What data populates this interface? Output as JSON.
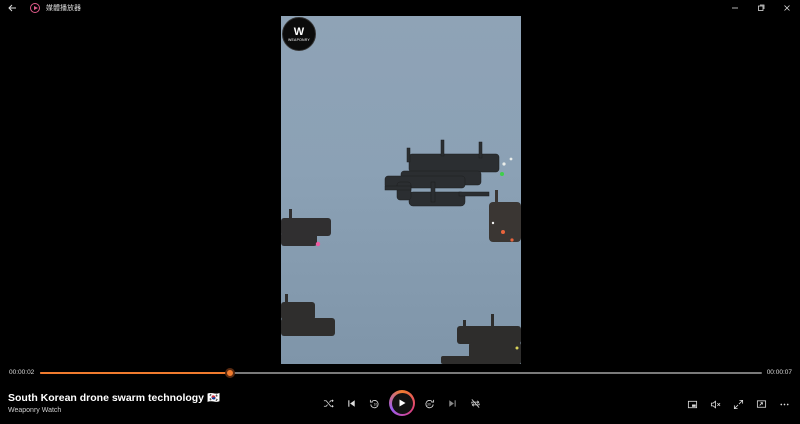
{
  "app": {
    "title": "媒體播放器",
    "back_icon": "back-arrow-icon",
    "window_controls": [
      "minimize-icon",
      "maximize-icon",
      "close-icon"
    ]
  },
  "video": {
    "watermark_text": "WEAPONRY",
    "watermark_glyph": "W"
  },
  "player": {
    "current_time": "00:00:02",
    "duration": "00:00:07",
    "progress_fraction": 0.263,
    "accent_color": "#f07b2e",
    "media_title": "South Korean drone swarm technology 🇰🇷",
    "media_subtitle": "Weaponry Watch",
    "controls": [
      "shuffle-icon",
      "previous-icon",
      "rewind-10-icon",
      "play-icon",
      "forward-30-icon",
      "next-icon",
      "repeat-off-icon"
    ],
    "right_controls": [
      "miniplayer-icon",
      "volume-icon",
      "fullscreen-icon",
      "cast-icon",
      "more-options-icon"
    ]
  }
}
